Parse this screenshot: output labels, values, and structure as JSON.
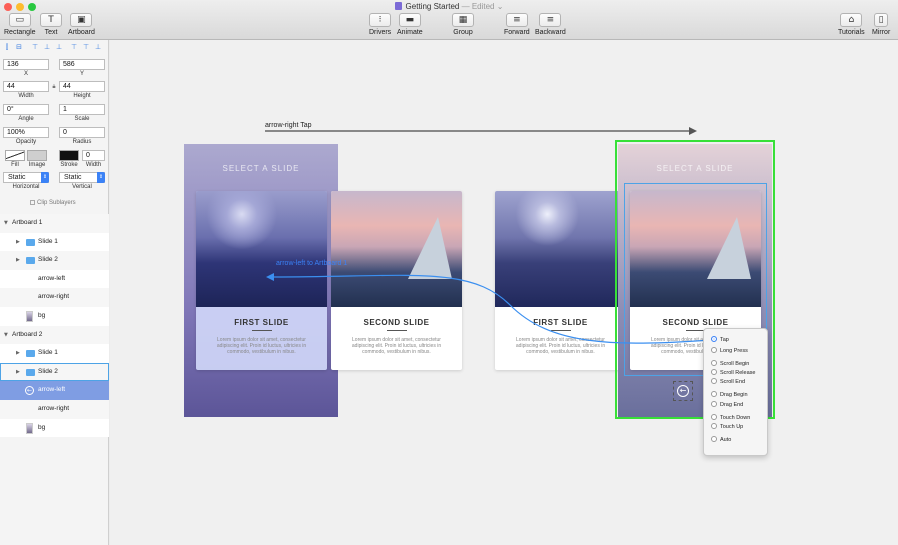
{
  "window": {
    "title": "Getting Started",
    "status": "— Edited",
    "chevron": "⌄"
  },
  "traffic_lights": {
    "close": "#fc5f57",
    "minimize": "#fdbc2e",
    "zoom": "#28c840"
  },
  "toolbar": {
    "rectangle": "Rectangle",
    "text": "Text",
    "artboard": "Artboard",
    "drivers": "Drivers",
    "animate": "Animate",
    "group": "Group",
    "forward": "Forward",
    "backward": "Backward",
    "tutorials": "Tutorials",
    "mirror": "Mirror"
  },
  "inspector": {
    "x": "136",
    "y": "586",
    "x_label": "X",
    "y_label": "Y",
    "width": "44",
    "height": "44",
    "width_label": "Width",
    "height_label": "Height",
    "angle": "0°",
    "scale": "1",
    "angle_label": "Angle",
    "scale_label": "Scale",
    "opacity": "100%",
    "radius": "0",
    "opacity_label": "Opacity",
    "radius_label": "Radius",
    "stroke_width": "0",
    "fill_label": "Fill",
    "image_label": "Image",
    "stroke_label": "Stroke",
    "swidth_label": "Width",
    "horizontal": "Static",
    "vertical": "Static",
    "horizontal_label": "Horizontal",
    "vertical_label": "Vertical",
    "clip_sublayers": "Clip Sublayers"
  },
  "layers": [
    {
      "label": "Artboard 1",
      "kind": "artboard"
    },
    {
      "label": "Slide 1",
      "kind": "folder"
    },
    {
      "label": "Slide 2",
      "kind": "folder"
    },
    {
      "label": "arrow-left",
      "kind": "plain"
    },
    {
      "label": "arrow-right",
      "kind": "plain"
    },
    {
      "label": "bg",
      "kind": "image"
    },
    {
      "label": "Artboard 2",
      "kind": "artboard"
    },
    {
      "label": "Slide 1",
      "kind": "folder"
    },
    {
      "label": "Slide 2",
      "kind": "folder",
      "state": "outlined"
    },
    {
      "label": "arrow-left",
      "kind": "circle",
      "state": "active"
    },
    {
      "label": "arrow-right",
      "kind": "plain"
    },
    {
      "label": "bg",
      "kind": "image"
    }
  ],
  "canvas": {
    "interaction_label": "arrow-right Tap",
    "connection_label": "arrow-left to Artboard 1",
    "artboard_heading": "SELECT A SLIDE",
    "card1_title": "FIRST SLIDE",
    "card2_title": "SECOND SLIDE",
    "card_body": "Lorem ipsum dolor sit amet, consectetur adipiscing elit. Proin id luctus, ultricies in commodo, vestibulum in nibus.",
    "prev_glyph": "←",
    "next_glyph": "→"
  },
  "gesture_menu": [
    "Tap",
    "Long Press",
    "Scroll Begin",
    "Scroll Release",
    "Scroll End",
    "Drag Begin",
    "Drag End",
    "Touch Down",
    "Touch Up",
    "Auto"
  ],
  "gesture_selected": "Tap"
}
